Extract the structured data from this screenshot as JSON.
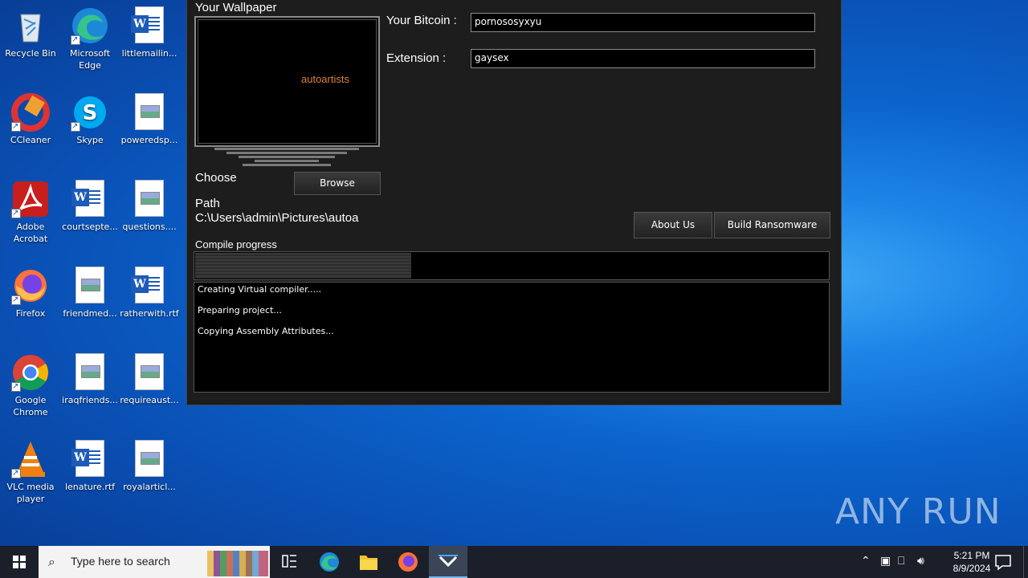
{
  "desktop": {
    "icons": [
      {
        "label": "Recycle Bin",
        "icon": "recycle-bin-icon"
      },
      {
        "label": "Microsoft Edge",
        "icon": "edge-icon"
      },
      {
        "label": "littlemailin...",
        "icon": "word-doc-icon"
      },
      {
        "label": "CCleaner",
        "icon": "ccleaner-icon"
      },
      {
        "label": "Skype",
        "icon": "skype-icon"
      },
      {
        "label": "poweredsp...",
        "icon": "image-file-icon"
      },
      {
        "label": "Adobe Acrobat",
        "icon": "acrobat-icon"
      },
      {
        "label": "courtsepte...",
        "icon": "word-doc-icon"
      },
      {
        "label": "questions....",
        "icon": "image-file-icon"
      },
      {
        "label": "Firefox",
        "icon": "firefox-icon"
      },
      {
        "label": "friendmed...",
        "icon": "image-file-icon"
      },
      {
        "label": "ratherwith.rtf",
        "icon": "word-doc-icon"
      },
      {
        "label": "Google Chrome",
        "icon": "chrome-icon"
      },
      {
        "label": "iraqfriends...",
        "icon": "image-file-icon"
      },
      {
        "label": "requireaust...",
        "icon": "image-file-icon"
      },
      {
        "label": "VLC media player",
        "icon": "vlc-icon"
      },
      {
        "label": "lenature.rtf",
        "icon": "word-doc-icon"
      },
      {
        "label": "royalarticl...",
        "icon": "image-file-icon"
      }
    ]
  },
  "app": {
    "wallpaper_title": "Your Wallpaper",
    "monitor_text": "autoartists",
    "choose_label": "Choose",
    "browse_button": "Browse",
    "path_label": "Path",
    "path_value": "C:\\Users\\admin\\Pictures\\autoa",
    "bitcoin_label": "Your Bitcoin :",
    "bitcoin_value": "pornososyxyu",
    "extension_label": "Extension :",
    "extension_value": "gaysex",
    "about_button": "About Us",
    "build_button": "Build Ransomware",
    "progress_label": "Compile progress",
    "progress_fraction": 0.34,
    "log": [
      "Creating Virtual compiler.....",
      "Preparing project...",
      "Copying Assembly Attributes..."
    ]
  },
  "taskbar": {
    "search_placeholder": "Type here to search",
    "time": "5:21 PM",
    "date": "8/9/2024",
    "pinned": [
      "task-view-icon",
      "edge-icon",
      "file-explorer-icon",
      "firefox-icon",
      "ransomware-builder-icon"
    ]
  },
  "watermark": "ANY RUN"
}
